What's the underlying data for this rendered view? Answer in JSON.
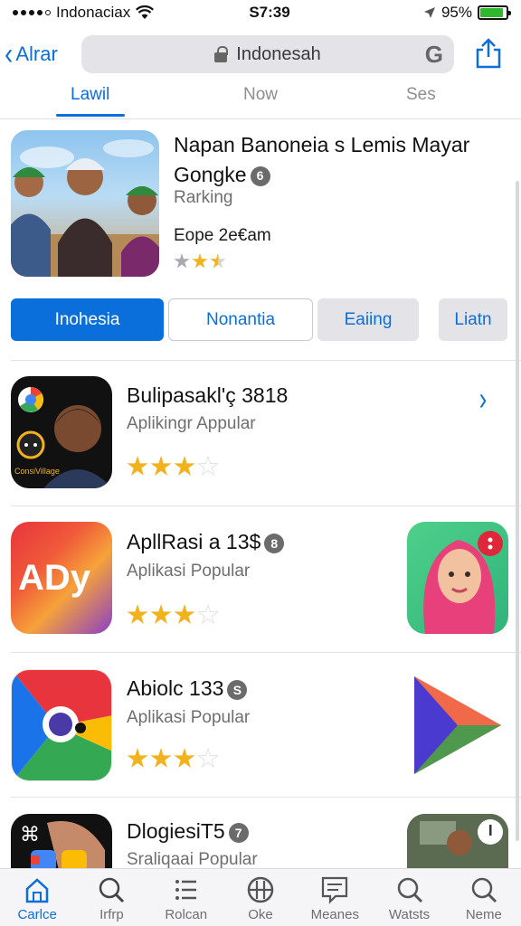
{
  "status_bar": {
    "carrier": "Indonaciax",
    "time": "S7:39",
    "battery": "95%"
  },
  "nav": {
    "back_label": "Alrar",
    "search_text": "Indonesah",
    "search_g": "G"
  },
  "tabs": [
    "Lawil",
    "Now",
    "Ses"
  ],
  "featured": {
    "title_line1": "Napan Banoneia s Lemis Mayar",
    "title_line2": "Gongke",
    "badge": "6",
    "subtitle": "Rarking",
    "meta": "Eope 2e€am",
    "rating": 2.5
  },
  "segments": [
    "Inohesia",
    "Nonantia",
    "Eaiing",
    "Liatn"
  ],
  "apps": [
    {
      "title": "Bulipasakl'ç 3818",
      "badge": "",
      "subtitle": "Aplikingr Appular",
      "rating": 3,
      "icon_text": "ConsiVillage"
    },
    {
      "title": "ApllRasi a 13$",
      "badge": "8",
      "subtitle": "Aplikasi Popular",
      "rating": 3,
      "icon_text": "ADy"
    },
    {
      "title": "Abiolc 133",
      "badge": "S",
      "subtitle": "Aplikasi Popular",
      "rating": 3,
      "icon_text": ""
    },
    {
      "title": "DlogiesiT5",
      "badge": "7",
      "subtitle": "Sraliqaai Popular",
      "rating": 0,
      "icon_text": ""
    }
  ],
  "tabbar": [
    "Carlce",
    "Irfrp",
    "Rolcan",
    "Oke",
    "Meanes",
    "Watsts",
    "Neme"
  ],
  "colors": {
    "accent": "#0a6edb",
    "star": "#f2b21c"
  }
}
